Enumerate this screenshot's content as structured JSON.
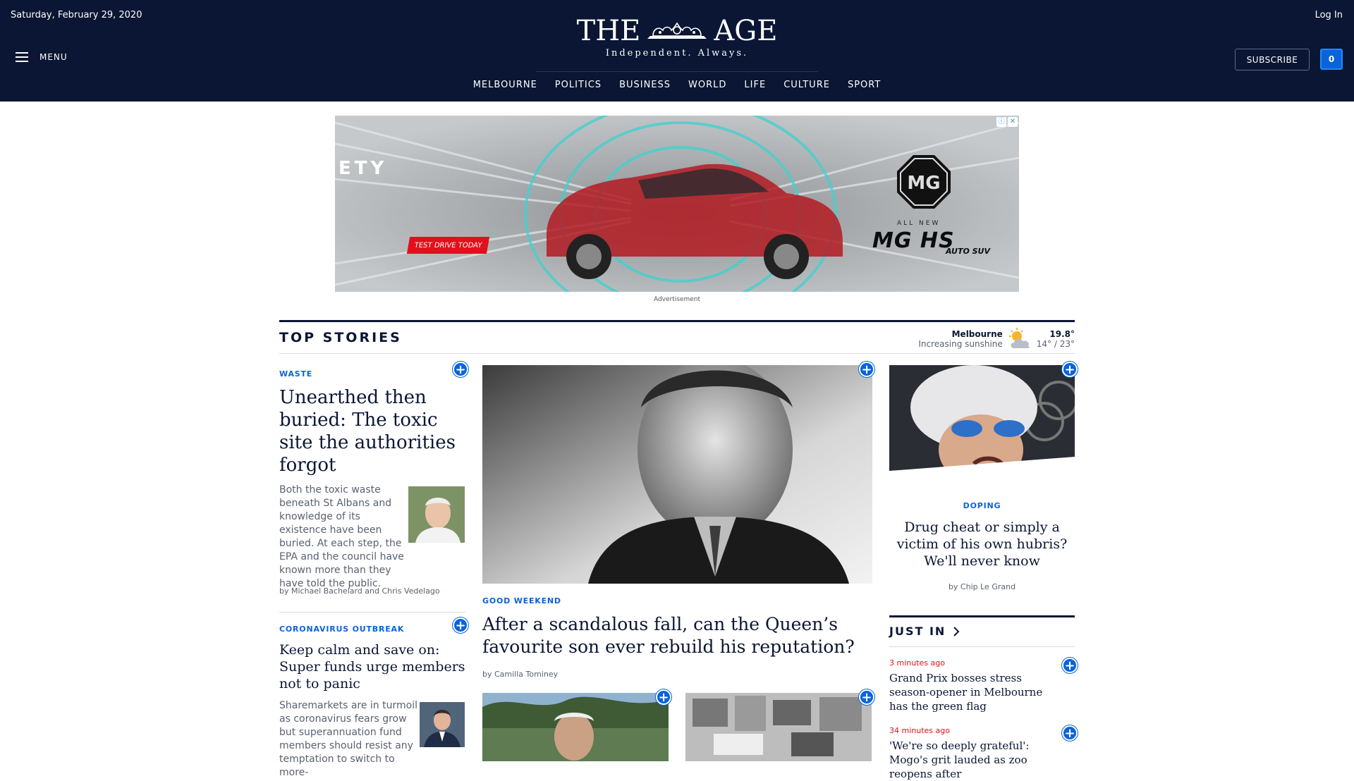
{
  "header": {
    "date": "Saturday, February 29, 2020",
    "login": "Log In",
    "menu": "MENU",
    "logo_left": "THE",
    "logo_right": "AGE",
    "tagline": "Independent. Always.",
    "subscribe": "SUBSCRIBE",
    "count": "0",
    "nav": [
      "MELBOURNE",
      "POLITICS",
      "BUSINESS",
      "WORLD",
      "LIFE",
      "CULTURE",
      "SPORT"
    ]
  },
  "ad": {
    "partial_text": "ETY",
    "cta": "TEST DRIVE TODAY",
    "all_new": "ALL NEW",
    "model": "MG HS",
    "model_suffix": "AUTO SUV",
    "label": "Advertisement",
    "icons": [
      "info-icon",
      "close-icon"
    ]
  },
  "top_stories": {
    "title": "TOP STORIES",
    "weather": {
      "city": "Melbourne",
      "desc": "Increasing sunshine",
      "temp": "19.8°",
      "range": "14° / 23°",
      "icon": "partly-sunny-icon"
    }
  },
  "stories": {
    "waste": {
      "kicker": "WASTE",
      "headline": "Unearthed then buried: The toxic site the authorities forgot",
      "summary": "Both the toxic waste beneath St Albans and knowledge of its existence have been buried. At each step, the EPA and the council have known more than they have told the public.",
      "byline": "by Michael Bachelard and Chris Vedelago"
    },
    "corona": {
      "kicker": "CORONAVIRUS OUTBREAK",
      "headline": "Keep calm and save on: Super funds urge members not to panic",
      "summary": "Sharemarkets are in turmoil as coronavirus fears grow but superannuation fund members should resist any temptation to switch to more-"
    },
    "lead": {
      "kicker": "GOOD WEEKEND",
      "headline": "After a scandalous fall, can the Queen’s favourite son ever rebuild his reputation?",
      "byline": "by Camilla Tominey"
    },
    "doping": {
      "kicker": "DOPING",
      "headline": "Drug cheat or simply a victim of his own hubris? We'll never know",
      "byline": "by Chip Le Grand"
    }
  },
  "just_in": {
    "title": "JUST IN",
    "items": [
      {
        "time": "3 minutes ago",
        "headline": "Grand Prix bosses stress season-opener in Melbourne has the green flag"
      },
      {
        "time": "34 minutes ago",
        "headline": "'We're so deeply grateful': Mogo's grit lauded as zoo reopens after"
      }
    ]
  },
  "colors": {
    "navy": "#0a1633",
    "accent": "#0a63d8",
    "time_red": "#e2101c"
  }
}
